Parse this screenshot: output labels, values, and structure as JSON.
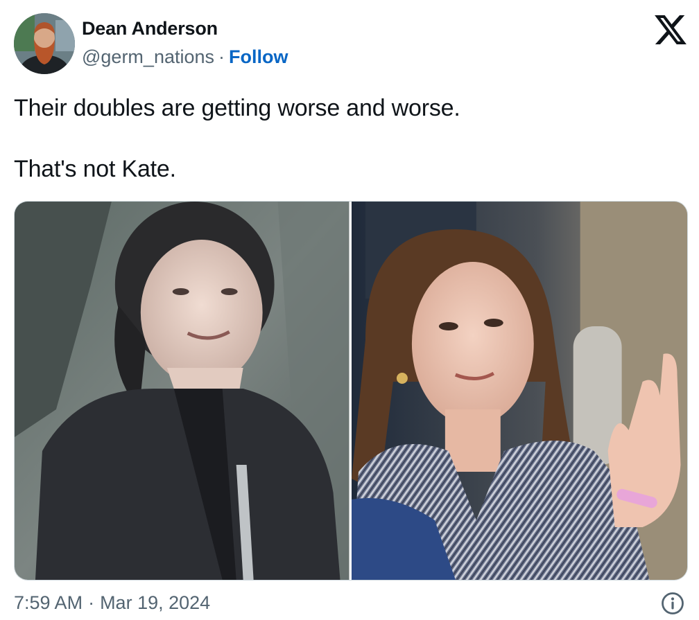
{
  "author": {
    "name": "Dean Anderson",
    "handle": "@germ_nations",
    "separator": "·",
    "follow_label": "Follow",
    "avatar_icon": "profile-photo-bearded-man"
  },
  "brand": {
    "logo_icon": "x-logo-icon"
  },
  "tweet": {
    "lines": [
      "Their doubles are getting worse and worse.",
      "That's not Kate."
    ]
  },
  "media": {
    "photos": [
      {
        "name": "left-photo",
        "description_icon": "photo-woman-dark-jacket-smiling"
      },
      {
        "name": "right-photo",
        "description_icon": "photo-woman-tweed-coat-waving"
      }
    ]
  },
  "footer": {
    "time": "7:59 AM",
    "separator": "·",
    "date": "Mar 19, 2024",
    "info_icon": "info-icon"
  },
  "colors": {
    "text": "#0f1419",
    "muted": "#536471",
    "link": "#0866c5",
    "border": "#cfd9de"
  }
}
